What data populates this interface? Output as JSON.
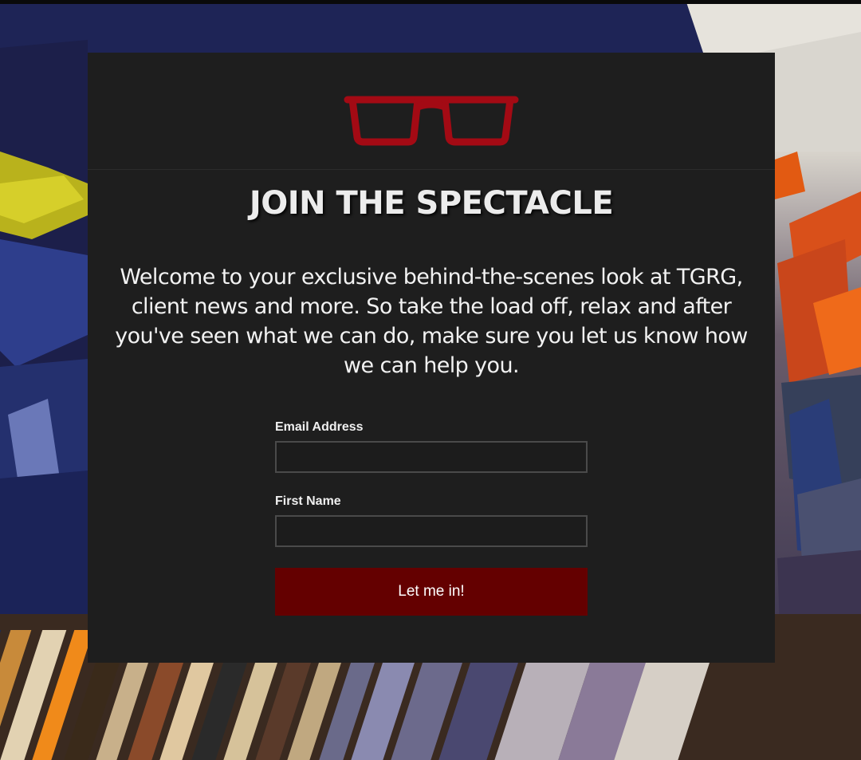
{
  "logo": {
    "icon": "eyeglasses-icon",
    "color": "#a30a14"
  },
  "signup": {
    "title": "JOIN THE SPECTACLE",
    "intro": "Welcome to your exclusive behind-the-scenes look at TGRG, client news and more. So take the load off, relax and after you've seen what we can do, make sure you let us know how we can help you.",
    "email_label": "Email Address",
    "email_value": "",
    "first_name_label": "First Name",
    "first_name_value": "",
    "submit_label": "Let me in!"
  },
  "colors": {
    "card_background": "#1e1e1e",
    "button_background": "#640000",
    "accent_red": "#a30a14"
  }
}
